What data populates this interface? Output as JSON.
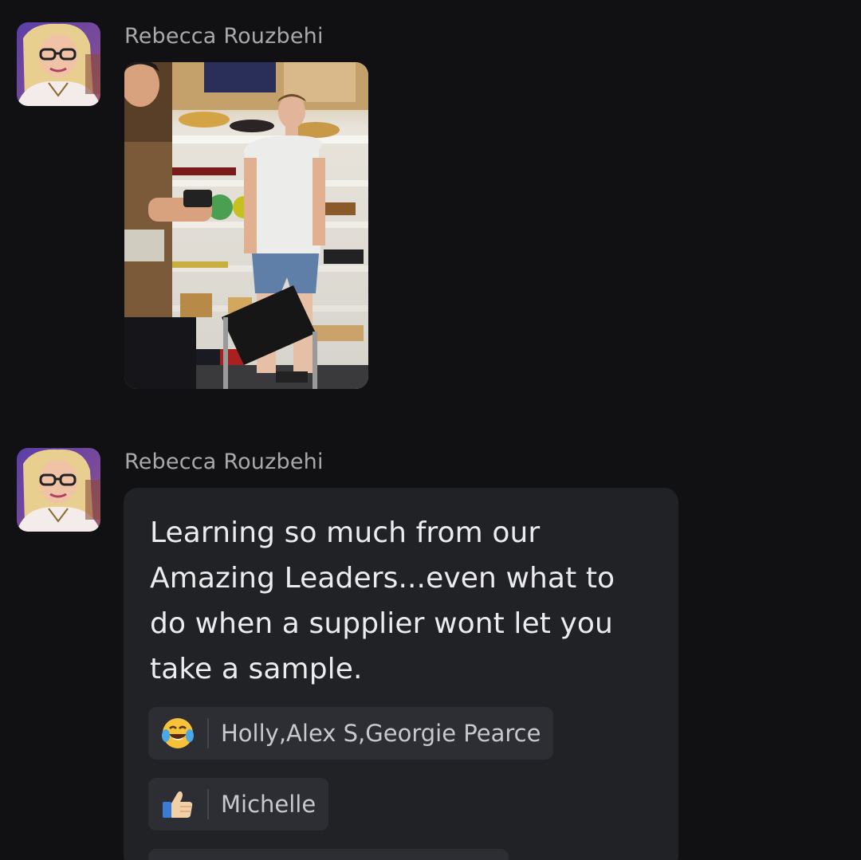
{
  "messages": [
    {
      "sender": "Rebecca Rouzbehi",
      "type": "photo"
    },
    {
      "sender": "Rebecca Rouzbehi",
      "type": "text",
      "text": "Learning so much from our Amazing Leaders...even what to do when a supplier wont let you take a sample.",
      "reactions": [
        {
          "emoji": "laughing-tears-emoji",
          "names": "Holly,Alex S,Georgie Pearce"
        },
        {
          "emoji": "thumbs-up-emoji",
          "names": "Michelle"
        }
      ]
    }
  ],
  "colors": {
    "background": "#111113",
    "bubble": "#212226",
    "reaction_chip": "#2d2e33",
    "sender_text": "#a9a9ad"
  }
}
